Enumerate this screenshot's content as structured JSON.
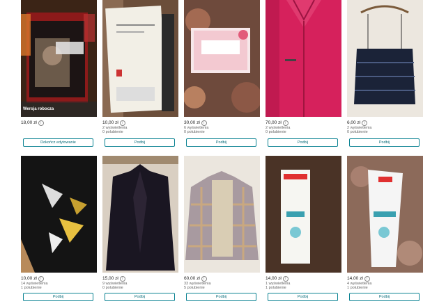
{
  "theme": {
    "accent": "#0a8292"
  },
  "items": [
    {
      "image": "dvd-joe-cocker-live",
      "badge": "Wersja robocza",
      "price": "18,00 zł",
      "stats": [],
      "button": "Dokończ edytowanie"
    },
    {
      "image": "planner-diary",
      "price": "10,00 zł",
      "stats": [
        "2 wyświetlenia",
        "0 polubienie"
      ],
      "button": "Podbij"
    },
    {
      "image": "stickers-pack",
      "price": "30,00 zł",
      "stats": [
        "6 wyświetlenia",
        "0 polubienie"
      ],
      "button": "Podbij"
    },
    {
      "image": "pink-fleece-jacket",
      "price": "70,00 zł",
      "stats": [
        "2 wyświetlenia",
        "0 polubienie"
      ],
      "button": "Podbij"
    },
    {
      "image": "navy-knit-top-on-hanger",
      "price": "6,00 zł",
      "stats": [
        "2 wyświetlenia",
        "0 polubienie"
      ],
      "button": "Podbij"
    },
    {
      "image": "embroidered-butterfly-sweater",
      "price": "10,00 zł",
      "stats": [
        "14 wyświetlenia",
        "1 polubienie"
      ],
      "button": "Podbij"
    },
    {
      "image": "velvet-blazer",
      "price": "15,00 zł",
      "stats": [
        "9 wyświetlenia",
        "0 polubienie"
      ],
      "button": "Podbij"
    },
    {
      "image": "plaid-shirt-jacket",
      "price": "60,00 zł",
      "stats": [
        "33 wyświetlenia",
        "5 polubienie"
      ],
      "button": "Podbij"
    },
    {
      "image": "ziaja-cream-box",
      "price": "14,00 zł",
      "stats": [
        "1 wyświetlenia",
        "1 polubienie"
      ],
      "button": "Podbij"
    },
    {
      "image": "ziaja-cream-tube",
      "price": "14,00 zł",
      "stats": [
        "4 wyświetlenia",
        "1 polubienie"
      ],
      "button": "Podbij"
    }
  ]
}
